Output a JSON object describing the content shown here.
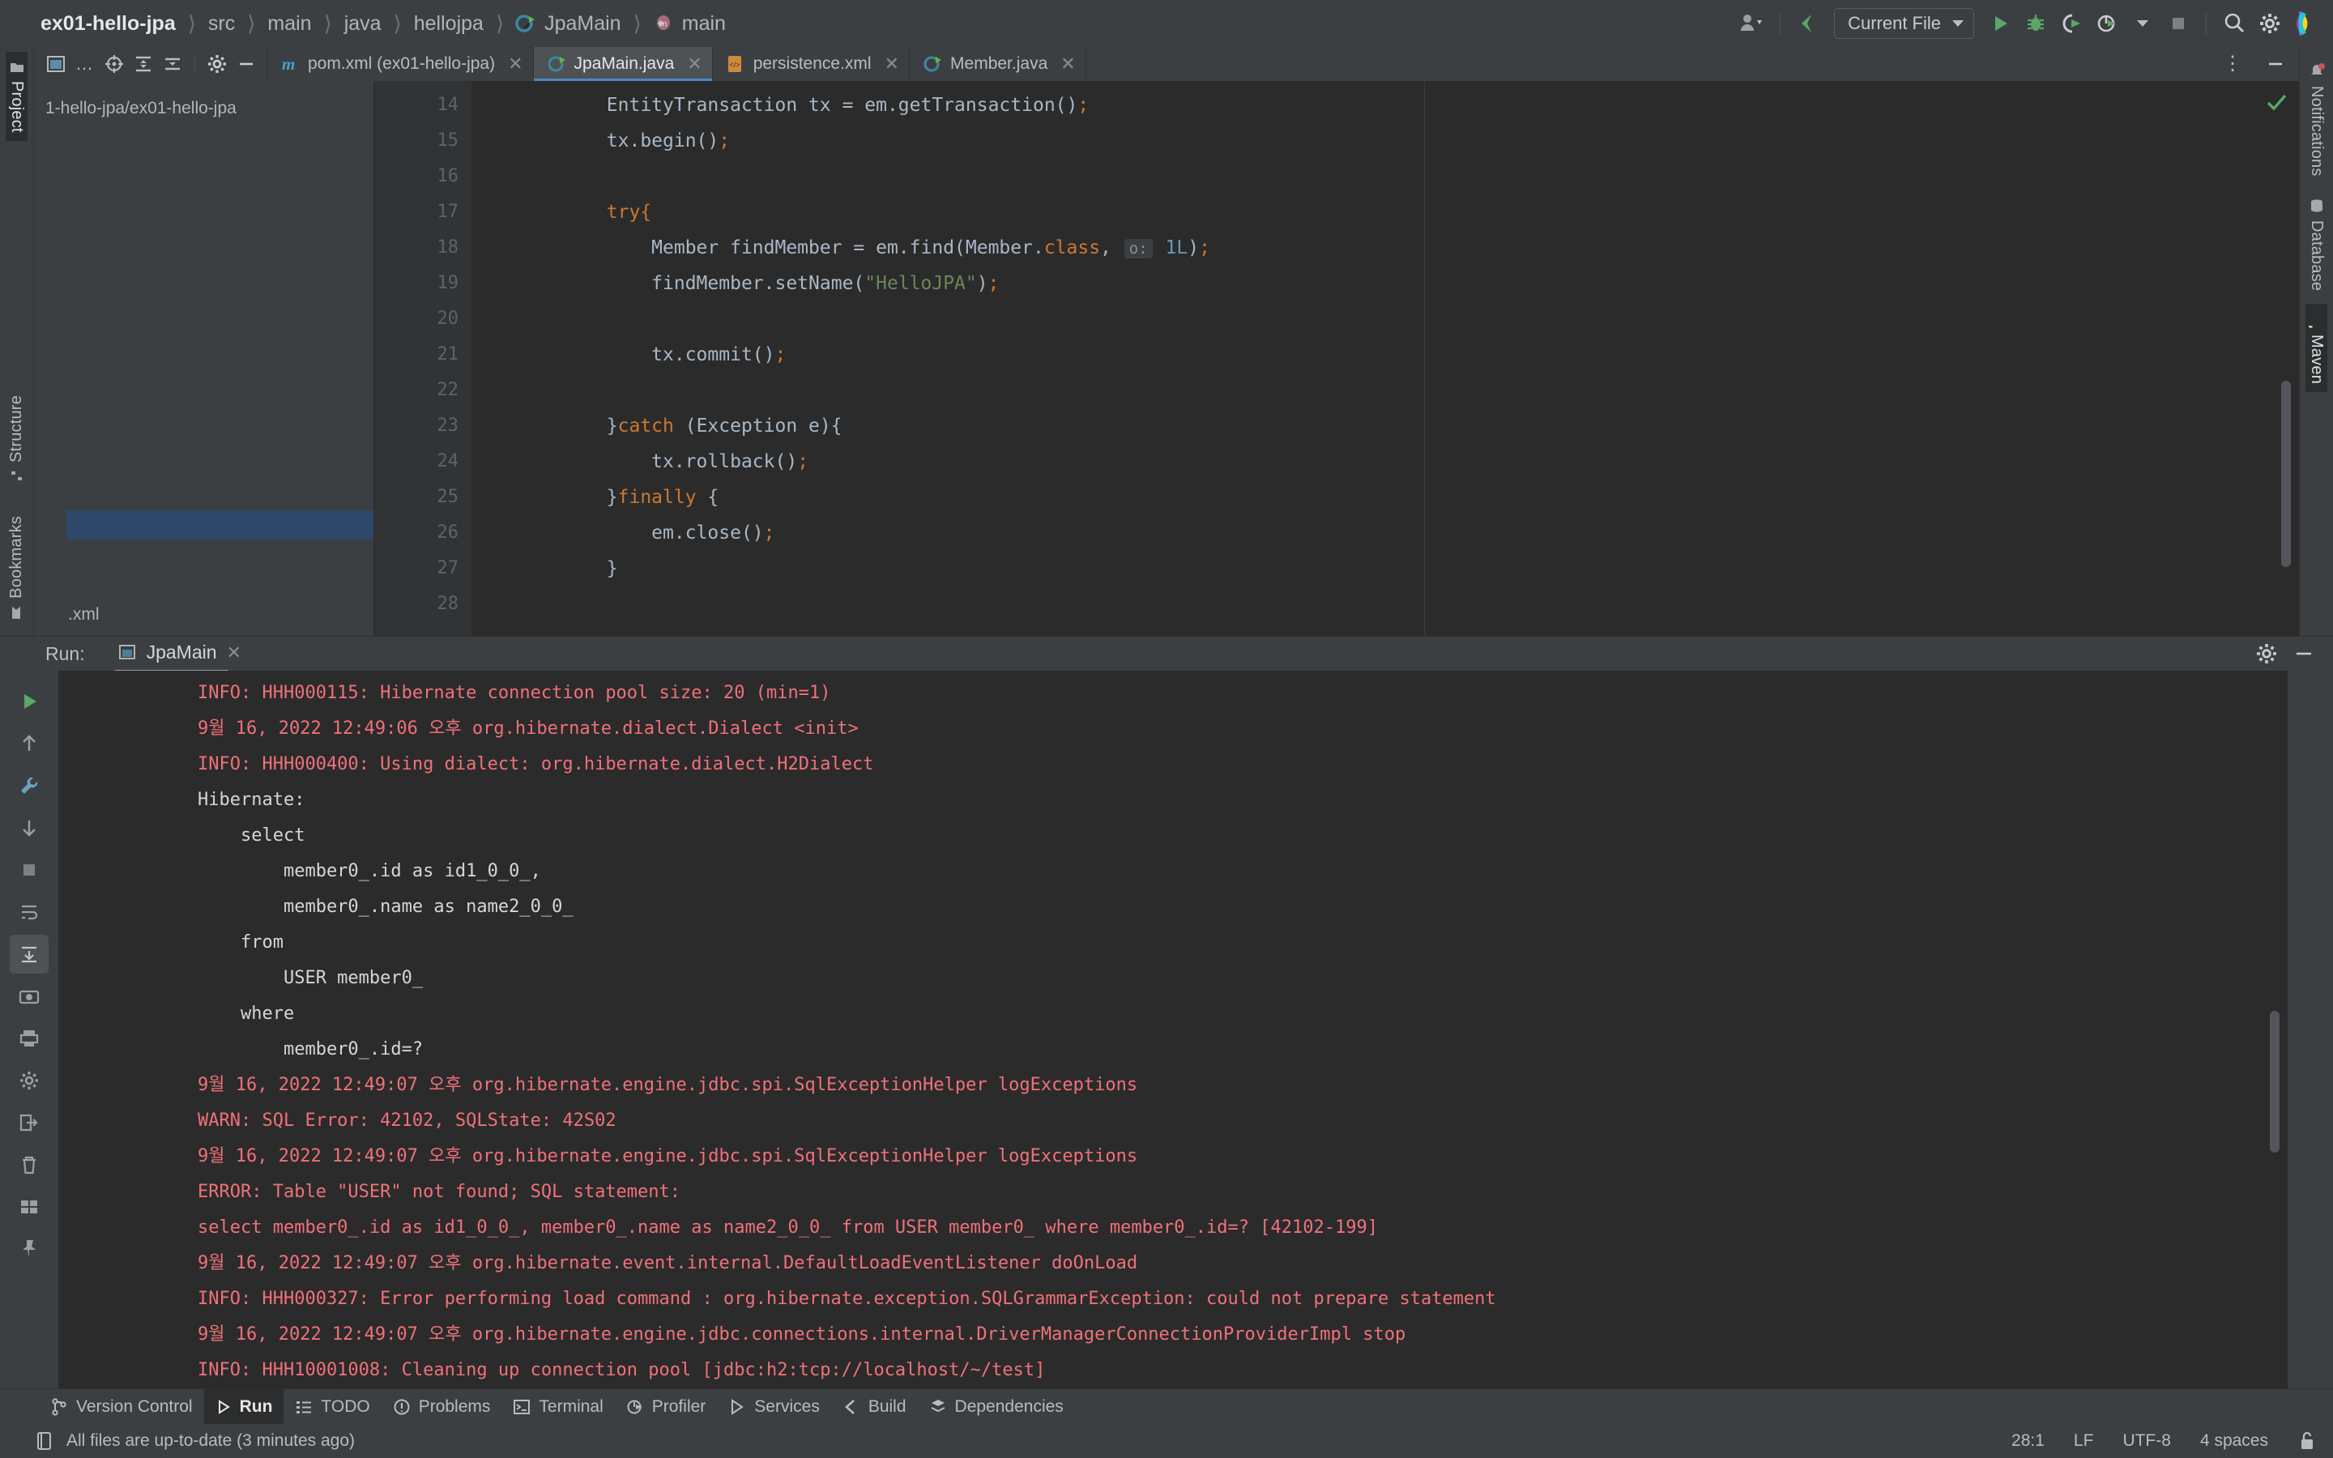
{
  "window": {
    "breadcrumb": [
      {
        "label": "ex01-hello-jpa",
        "icon": "none",
        "root": true
      },
      {
        "label": "src",
        "icon": "none"
      },
      {
        "label": "main",
        "icon": "none"
      },
      {
        "label": "java",
        "icon": "none"
      },
      {
        "label": "hellojpa",
        "icon": "none"
      },
      {
        "label": "JpaMain",
        "icon": "class-icon"
      },
      {
        "label": "main",
        "icon": "method-icon"
      }
    ]
  },
  "toolbar": {
    "run_config": "Current File",
    "buttons": [
      {
        "name": "account-icon",
        "label": ""
      },
      {
        "name": "updates-icon",
        "label": ""
      },
      {
        "name": "run-icon",
        "label": ""
      },
      {
        "name": "debug-icon",
        "label": ""
      },
      {
        "name": "run-coverage-icon",
        "label": ""
      },
      {
        "name": "profiler-icon",
        "label": ""
      },
      {
        "name": "stop-icon",
        "label": ""
      },
      {
        "name": "search-icon",
        "label": ""
      },
      {
        "name": "settings-icon",
        "label": ""
      },
      {
        "name": "ide-logo-icon",
        "label": ""
      }
    ]
  },
  "left_tool_bar": {
    "top": [
      {
        "label": "Project",
        "active": true
      }
    ],
    "bottom": [
      {
        "label": "Structure",
        "active": false
      },
      {
        "label": "Bookmarks",
        "active": false
      }
    ]
  },
  "right_tool_bar": {
    "items": [
      {
        "label": "Notifications",
        "icon": "bell-icon",
        "badge": true,
        "active": false
      },
      {
        "label": "Database",
        "icon": "database-icon",
        "active": false
      },
      {
        "label": "Maven",
        "icon": "maven-icon",
        "active": true
      }
    ]
  },
  "editor": {
    "tab_toolbar": [
      "project-view-icon",
      "more-icon",
      "locate-icon",
      "expand-collapse-icon",
      "collapse-all-icon",
      "settings-icon",
      "hide-icon"
    ],
    "tabs": [
      {
        "label": "pom.xml (ex01-hello-jpa)",
        "icon": "maven-file-icon",
        "active": false,
        "closable": true
      },
      {
        "label": "JpaMain.java",
        "icon": "java-class-icon",
        "active": true,
        "closable": true
      },
      {
        "label": "persistence.xml",
        "icon": "xml-file-icon",
        "active": false,
        "closable": true
      },
      {
        "label": "Member.java",
        "icon": "java-class-icon",
        "active": false,
        "closable": true
      }
    ],
    "project_pane": {
      "path_text": "1-hello-jpa/ex01-hello-jpa",
      "bottom_text": ".xml"
    },
    "lines": [
      {
        "no": "14",
        "fold": "",
        "code": "        EntityTransaction tx = em.getTransaction();"
      },
      {
        "no": "15",
        "fold": "",
        "code": "        tx.begin();"
      },
      {
        "no": "16",
        "fold": "",
        "code": ""
      },
      {
        "no": "17",
        "fold": "minus",
        "code": "        try{"
      },
      {
        "no": "18",
        "fold": "",
        "code": "            Member findMember = em.find(Member.class,  o: 1L);"
      },
      {
        "no": "19",
        "fold": "",
        "code": "            findMember.setName(\"HelloJPA\");"
      },
      {
        "no": "20",
        "fold": "",
        "code": ""
      },
      {
        "no": "21",
        "fold": "",
        "code": "            tx.commit();"
      },
      {
        "no": "22",
        "fold": "",
        "code": ""
      },
      {
        "no": "23",
        "fold": "minus",
        "code": "        }catch (Exception e){"
      },
      {
        "no": "24",
        "fold": "",
        "code": "            tx.rollback();"
      },
      {
        "no": "25",
        "fold": "arrow",
        "code": "        }finally {"
      },
      {
        "no": "26",
        "fold": "",
        "code": "            em.close();"
      },
      {
        "no": "27",
        "fold": "arrow",
        "code": "        }"
      },
      {
        "no": "28",
        "fold": "",
        "code": ""
      }
    ]
  },
  "run_window": {
    "label": "Run:",
    "tab": "JpaMain",
    "tools": [
      "rerun-icon",
      "scroll-up-icon",
      "scroll-down-icon",
      "wrench-icon",
      "stop-icon",
      "layout-icon",
      "soft-wrap-icon",
      "camera-icon",
      "scroll-end-icon",
      "print-icon",
      "settings-gear-icon",
      "trash-icon",
      "grid-icon",
      "pin-icon"
    ],
    "console": [
      {
        "text": "INFO: HHH000115: Hibernate connection pool size: 20 (min=1)",
        "type": "err"
      },
      {
        "text": "9월 16, 2022 12:49:06 오후 org.hibernate.dialect.Dialect <init>",
        "type": "err"
      },
      {
        "text": "INFO: HHH000400: Using dialect: org.hibernate.dialect.H2Dialect",
        "type": "err"
      },
      {
        "text": "Hibernate: ",
        "type": "out"
      },
      {
        "text": "    select",
        "type": "out"
      },
      {
        "text": "        member0_.id as id1_0_0_,",
        "type": "out"
      },
      {
        "text": "        member0_.name as name2_0_0_",
        "type": "out"
      },
      {
        "text": "    from",
        "type": "out"
      },
      {
        "text": "        USER member0_",
        "type": "out"
      },
      {
        "text": "    where",
        "type": "out"
      },
      {
        "text": "        member0_.id=?",
        "type": "out"
      },
      {
        "text": "9월 16, 2022 12:49:07 오후 org.hibernate.engine.jdbc.spi.SqlExceptionHelper logExceptions",
        "type": "err"
      },
      {
        "text": "WARN: SQL Error: 42102, SQLState: 42S02",
        "type": "err"
      },
      {
        "text": "9월 16, 2022 12:49:07 오후 org.hibernate.engine.jdbc.spi.SqlExceptionHelper logExceptions",
        "type": "err"
      },
      {
        "text": "ERROR: Table \"USER\" not found; SQL statement:",
        "type": "err"
      },
      {
        "text": "select member0_.id as id1_0_0_, member0_.name as name2_0_0_ from USER member0_ where member0_.id=? [42102-199]",
        "type": "err"
      },
      {
        "text": "9월 16, 2022 12:49:07 오후 org.hibernate.event.internal.DefaultLoadEventListener doOnLoad",
        "type": "err"
      },
      {
        "text": "INFO: HHH000327: Error performing load command : org.hibernate.exception.SQLGrammarException: could not prepare statement",
        "type": "err"
      },
      {
        "text": "9월 16, 2022 12:49:07 오후 org.hibernate.engine.jdbc.connections.internal.DriverManagerConnectionProviderImpl stop",
        "type": "err"
      },
      {
        "text": "INFO: HHH10001008: Cleaning up connection pool [jdbc:h2:tcp://localhost/~/test]",
        "type": "err"
      }
    ]
  },
  "bottom_bar": {
    "items": [
      {
        "label": "Version Control",
        "icon": "vcs-icon",
        "active": false
      },
      {
        "label": "Run",
        "icon": "run-icon",
        "active": true
      },
      {
        "label": "TODO",
        "icon": "todo-icon",
        "active": false
      },
      {
        "label": "Problems",
        "icon": "problems-icon",
        "active": false
      },
      {
        "label": "Terminal",
        "icon": "terminal-icon",
        "active": false
      },
      {
        "label": "Profiler",
        "icon": "profiler-icon",
        "active": false
      },
      {
        "label": "Services",
        "icon": "services-icon",
        "active": false
      },
      {
        "label": "Build",
        "icon": "build-icon",
        "active": false
      },
      {
        "label": "Dependencies",
        "icon": "dependencies-icon",
        "active": false
      }
    ]
  },
  "status_bar": {
    "message": "All files are up-to-date (3 minutes ago)",
    "caret_position": "28:1",
    "line_separator": "LF",
    "encoding": "UTF-8",
    "indent": "4 spaces",
    "lock": "unlocked-icon"
  },
  "colors": {
    "accent_blue": "#4a88c7",
    "error_red": "#f07178",
    "keyword_orange": "#cc7832",
    "string_green": "#6a8759",
    "number_blue": "#6897bb",
    "green_run": "#59a869"
  }
}
